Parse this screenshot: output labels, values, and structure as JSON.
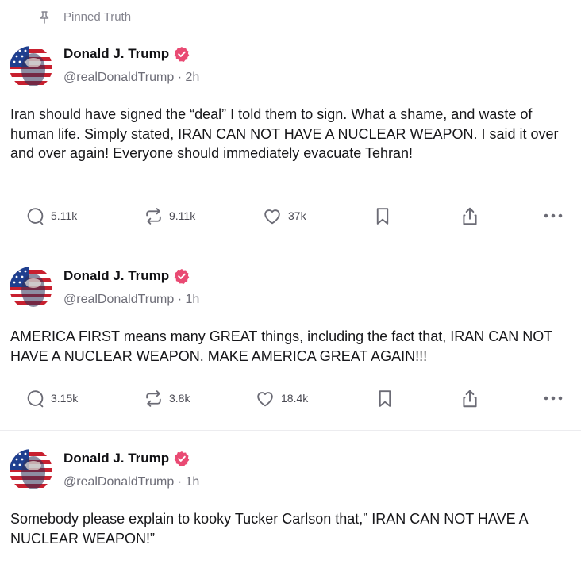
{
  "pinned": {
    "label": "Pinned Truth",
    "icon": "pin-icon"
  },
  "colors": {
    "verified": "#e94a73",
    "icon": "#6b6b75",
    "text": "#17171a",
    "muted": "#6e6e78"
  },
  "posts": [
    {
      "author": {
        "name": "Donald J. Trump",
        "handle": "@realDonaldTrump",
        "age": "2h",
        "meta": "@realDonaldTrump · 2h"
      },
      "text": "Iran should have signed the “deal” I told them to sign. What a shame, and waste of human life. Simply stated, IRAN CAN NOT HAVE A NUCLEAR WEAPON. I said it over and over again! Everyone should immediately evacuate Tehran!",
      "replies": "5.11k",
      "retruths": "9.11k",
      "likes": "37k"
    },
    {
      "author": {
        "name": "Donald J. Trump",
        "handle": "@realDonaldTrump",
        "age": "1h",
        "meta": "@realDonaldTrump · 1h"
      },
      "text": "AMERICA FIRST means many GREAT things, including the fact that, IRAN CAN NOT HAVE A NUCLEAR WEAPON. MAKE AMERICA GREAT AGAIN!!!",
      "replies": "3.15k",
      "retruths": "3.8k",
      "likes": "18.4k"
    },
    {
      "author": {
        "name": "Donald J. Trump",
        "handle": "@realDonaldTrump",
        "age": "1h",
        "meta": "@realDonaldTrump · 1h"
      },
      "text": "Somebody please explain to kooky Tucker Carlson that,” IRAN CAN NOT HAVE A NUCLEAR WEAPON!”"
    }
  ]
}
